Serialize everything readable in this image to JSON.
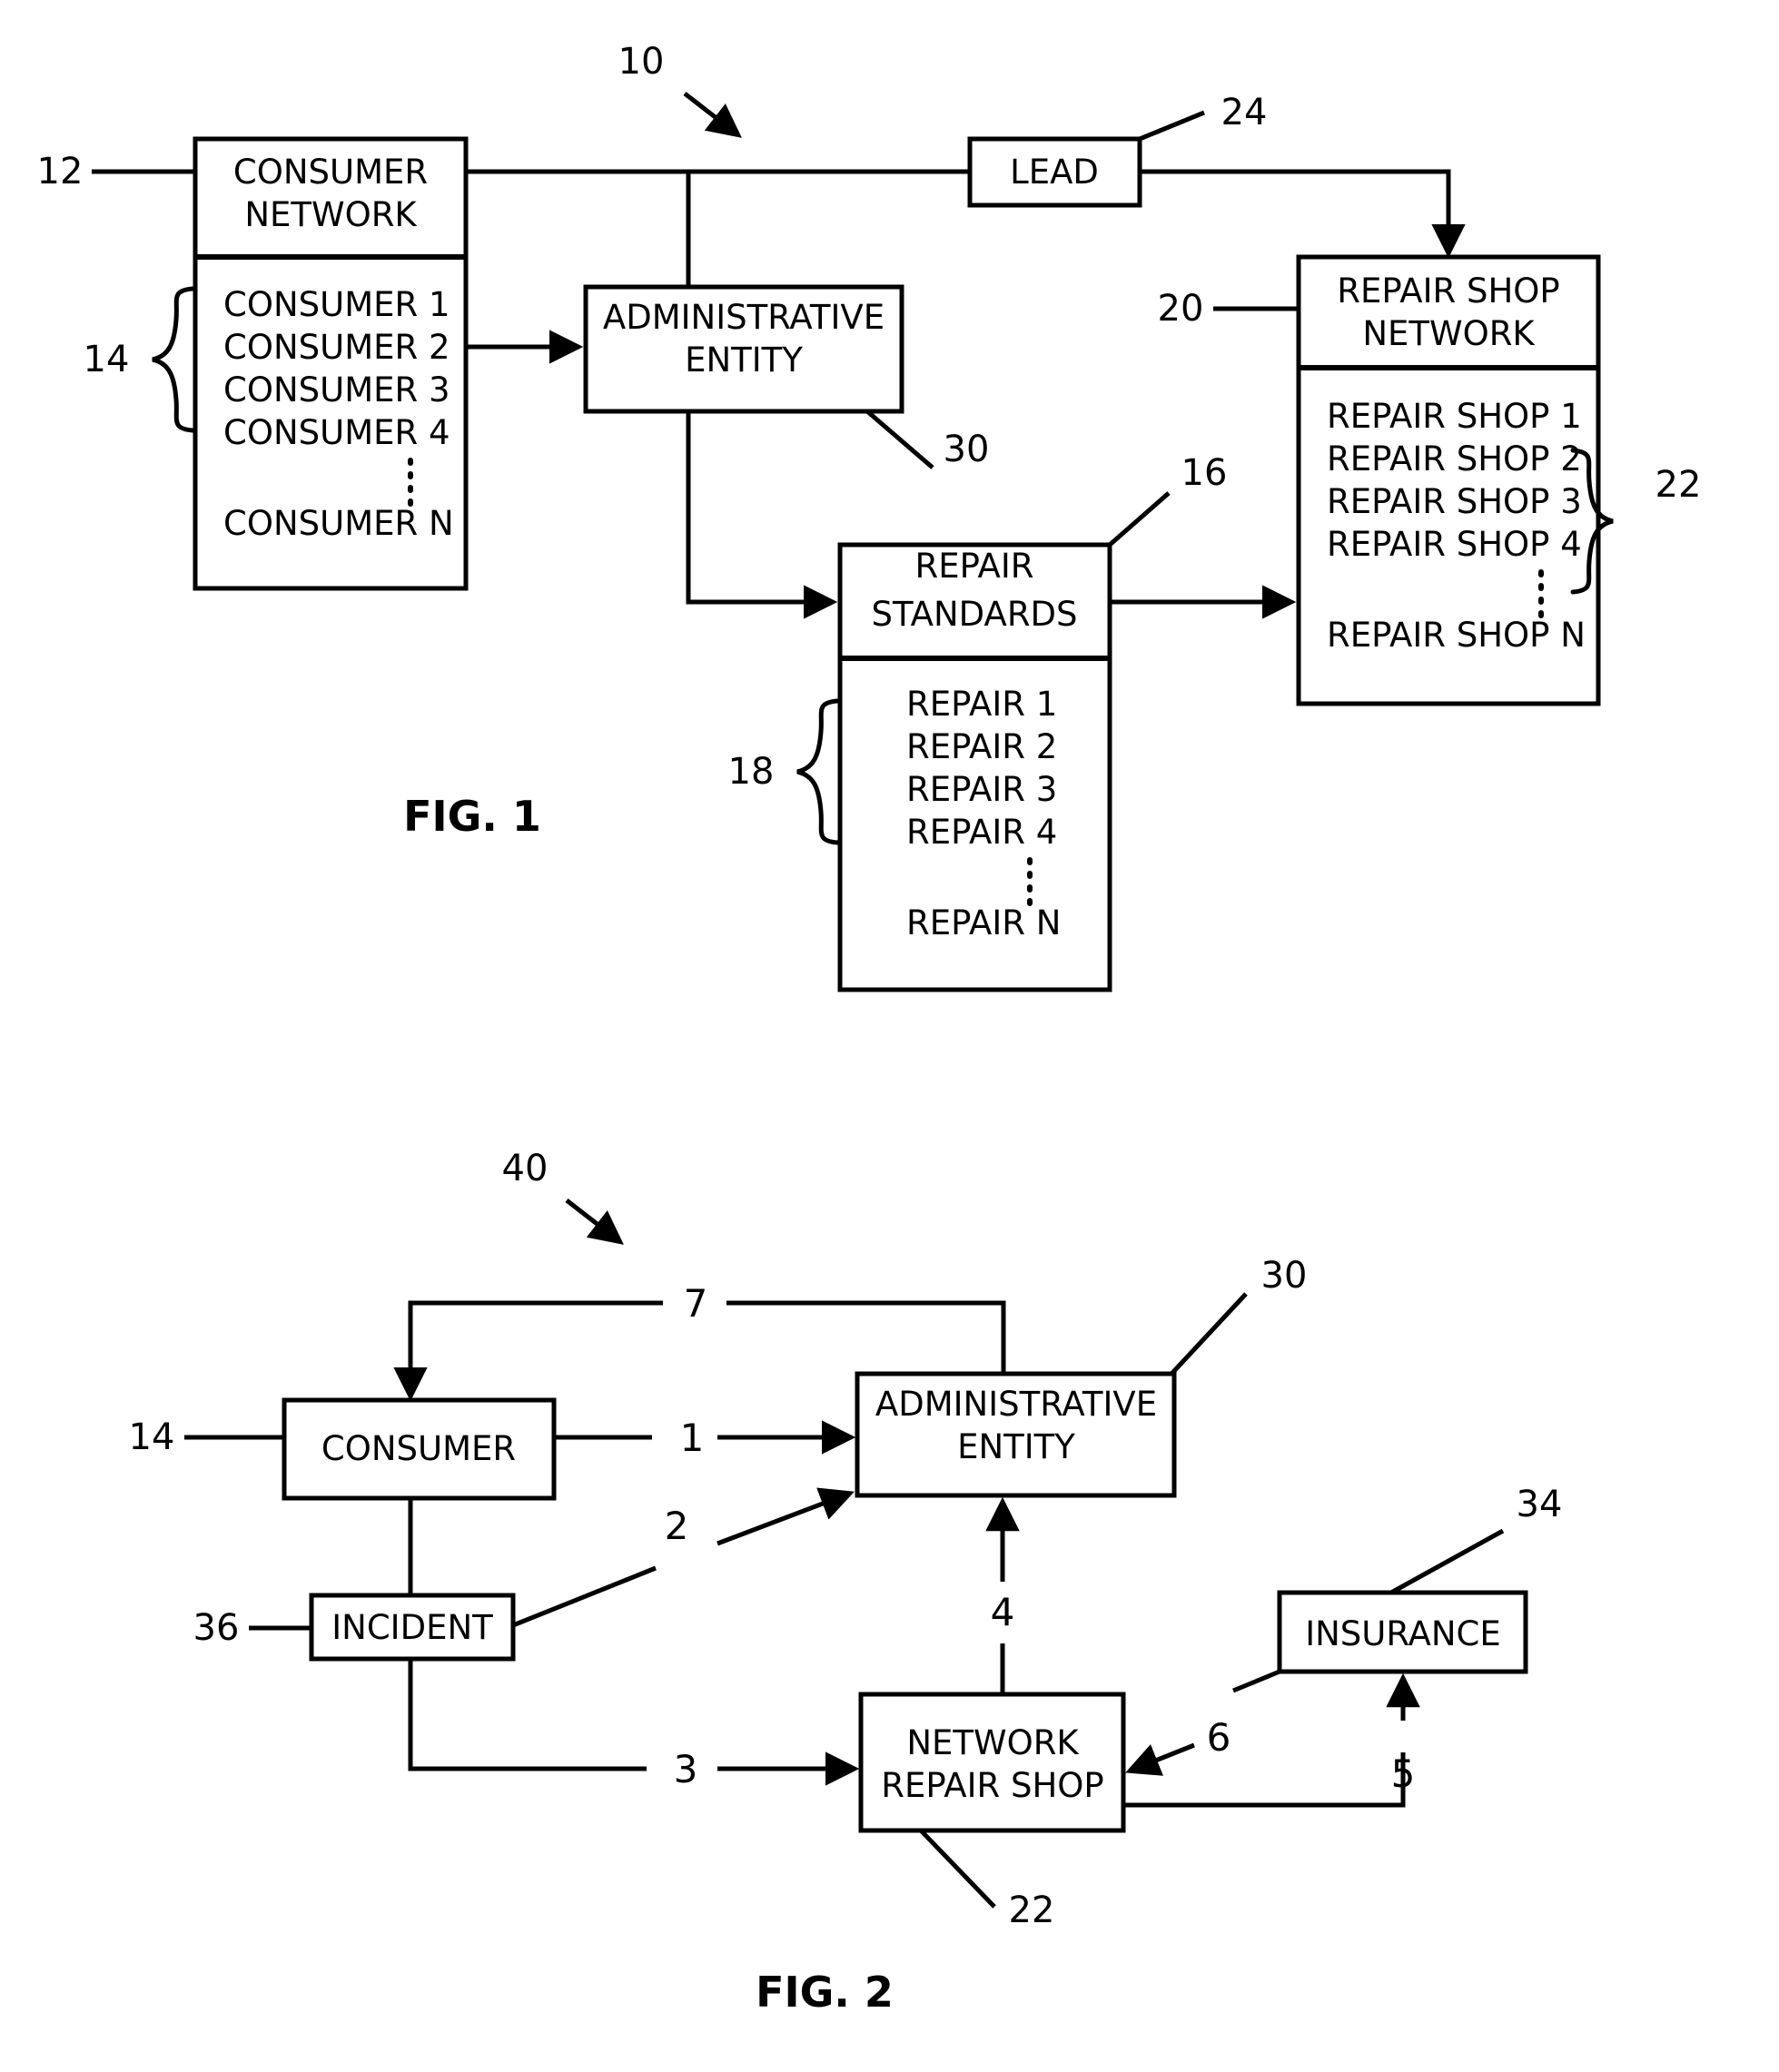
{
  "figures": [
    {
      "id": "fig1",
      "caption": "FIG. 1",
      "system_ref": "10",
      "boxes": {
        "consumer_network": {
          "title_line1": "CONSUMER",
          "title_line2": "NETWORK",
          "ref": "12",
          "list_ref": "14",
          "items": [
            "CONSUMER 1",
            "CONSUMER 2",
            "CONSUMER 3",
            "CONSUMER 4",
            "CONSUMER N"
          ]
        },
        "administrative_entity": {
          "title_line1": "ADMINISTRATIVE",
          "title_line2": "ENTITY",
          "ref": "30"
        },
        "lead": {
          "title": "LEAD",
          "ref": "24"
        },
        "repair_shop_network": {
          "title_line1": "REPAIR SHOP",
          "title_line2": "NETWORK",
          "ref": "20",
          "list_ref": "22",
          "items": [
            "REPAIR SHOP 1",
            "REPAIR SHOP 2",
            "REPAIR SHOP 3",
            "REPAIR SHOP 4",
            "REPAIR SHOP N"
          ]
        },
        "repair_standards": {
          "title_line1": "REPAIR",
          "title_line2": "STANDARDS",
          "ref": "16",
          "list_ref": "18",
          "items": [
            "REPAIR 1",
            "REPAIR 2",
            "REPAIR 3",
            "REPAIR 4",
            "REPAIR N"
          ]
        }
      }
    },
    {
      "id": "fig2",
      "caption": "FIG. 2",
      "system_ref": "40",
      "boxes": {
        "consumer": {
          "title": "CONSUMER",
          "ref": "14"
        },
        "incident": {
          "title": "INCIDENT",
          "ref": "36"
        },
        "administrative_entity": {
          "title_line1": "ADMINISTRATIVE",
          "title_line2": "ENTITY",
          "ref": "30"
        },
        "network_repair_shop": {
          "title_line1": "NETWORK",
          "title_line2": "REPAIR SHOP",
          "ref": "22"
        },
        "insurance": {
          "title": "INSURANCE",
          "ref": "34"
        }
      },
      "steps": [
        {
          "label": "1",
          "from": "consumer",
          "to": "administrative_entity"
        },
        {
          "label": "2",
          "from": "incident",
          "to": "administrative_entity"
        },
        {
          "label": "3",
          "from": "incident",
          "to": "network_repair_shop"
        },
        {
          "label": "4",
          "from": "network_repair_shop",
          "to": "administrative_entity"
        },
        {
          "label": "5",
          "from": "network_repair_shop",
          "to": "insurance"
        },
        {
          "label": "6",
          "from": "insurance",
          "to": "network_repair_shop"
        },
        {
          "label": "7",
          "from": "administrative_entity",
          "to": "consumer"
        }
      ]
    }
  ]
}
